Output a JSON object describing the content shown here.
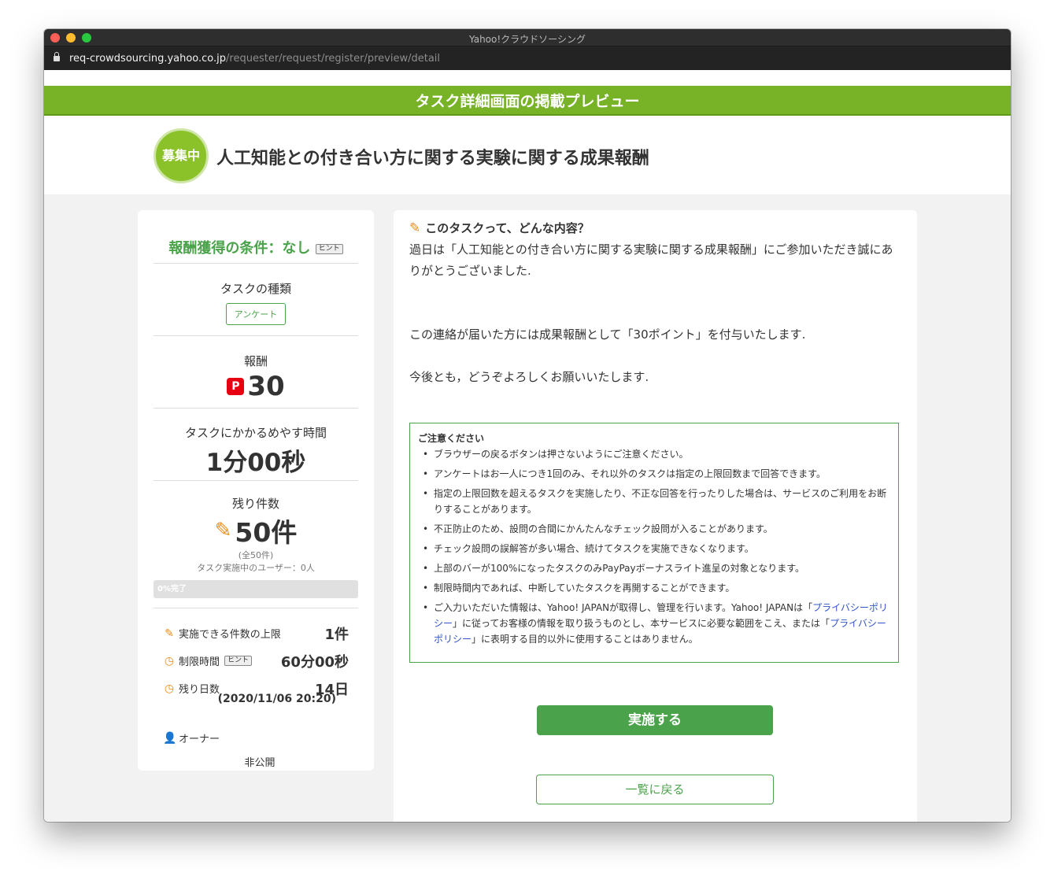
{
  "window": {
    "title": "Yahoo!クラウドソーシング",
    "url_host": "req-crowdsourcing.yahoo.co.jp",
    "url_path": "/requester/request/register/preview/detail"
  },
  "banner": {
    "text": "タスク詳細画面の掲載プレビュー"
  },
  "header": {
    "status_badge": "募集中",
    "task_title": "人工知能との付き合い方に関する実験に関する成果報酬"
  },
  "sidebar": {
    "condition": "報酬獲得の条件：なし",
    "hint_label": "ヒント",
    "task_type_label": "タスクの種類",
    "task_type_value": "アンケート",
    "reward_label": "報酬",
    "reward_icon": "P",
    "reward_value": "30",
    "time_label": "タスクにかかるめやす時間",
    "time_value": "1分00秒",
    "remain_label": "残り件数",
    "remain_value": "50件",
    "remain_total": "(全50件)",
    "users_in_progress": "タスク実施中のユーザー：0人",
    "progress_text": "0%完了",
    "progress_fraction": 0,
    "limit_label": "実施できる件数の上限",
    "limit_value": "1件",
    "time_limit_label": "制限時間",
    "time_limit_hint": "ヒント",
    "time_limit_value": "60分00秒",
    "days_left_label": "残り日数",
    "days_left_value": "14日",
    "deadline": "(2020/11/06 20:20)",
    "owner_label": "オーナー",
    "owner_value": "非公開"
  },
  "main": {
    "question_heading": "このタスクって、どんな内容？",
    "desc_line1": "過日は「人工知能との付き合い方に関する実験に関する成果報酬」にご参加いただき誠にありがとうございました.",
    "desc_line2": "この連絡が届いた方には成果報酬として「30ポイント」を付与いたします.",
    "desc_line3": "今後とも，どうぞよろしくお願いいたします.",
    "notice": {
      "title": "ご注意ください",
      "items": [
        "ブラウザーの戻るボタンは押さないようにご注意ください。",
        "アンケートはお一人につき1回のみ、それ以外のタスクは指定の上限回数まで回答できます。",
        "指定の上限回数を超えるタスクを実施したり、不正な回答を行ったりした場合は、サービスのご利用をお断りすることがあります。",
        "不正防止のため、設問の合間にかんたんなチェック設問が入ることがあります。",
        "チェック設問の誤解答が多い場合、続けてタスクを実施できなくなります。",
        "上部のバーが100%になったタスクのみPayPayボーナスライト進呈の対象となります。",
        "制限時間内であれば、中断していたタスクを再開することができます。"
      ],
      "last_item_part1": "ご入力いただいた情報は、Yahoo! JAPANが取得し、管理を行います。Yahoo! JAPANは「",
      "privacy_link_1": "プライバシーポリシー",
      "last_item_part2": "」に従ってお客様の情報を取り扱うものとし、本サービスに必要な範囲をこえ、または「",
      "privacy_link_2": "プライバシーポリシー",
      "last_item_part3": "」に表明する目的以外に使用することはありません。"
    },
    "do_button": "実施する",
    "back_button": "一覧に戻る"
  },
  "colors": {
    "brand_green": "#77b227",
    "button_green": "#4aa34a",
    "accent_orange": "#f08c14",
    "paypay_red": "#e60012"
  }
}
